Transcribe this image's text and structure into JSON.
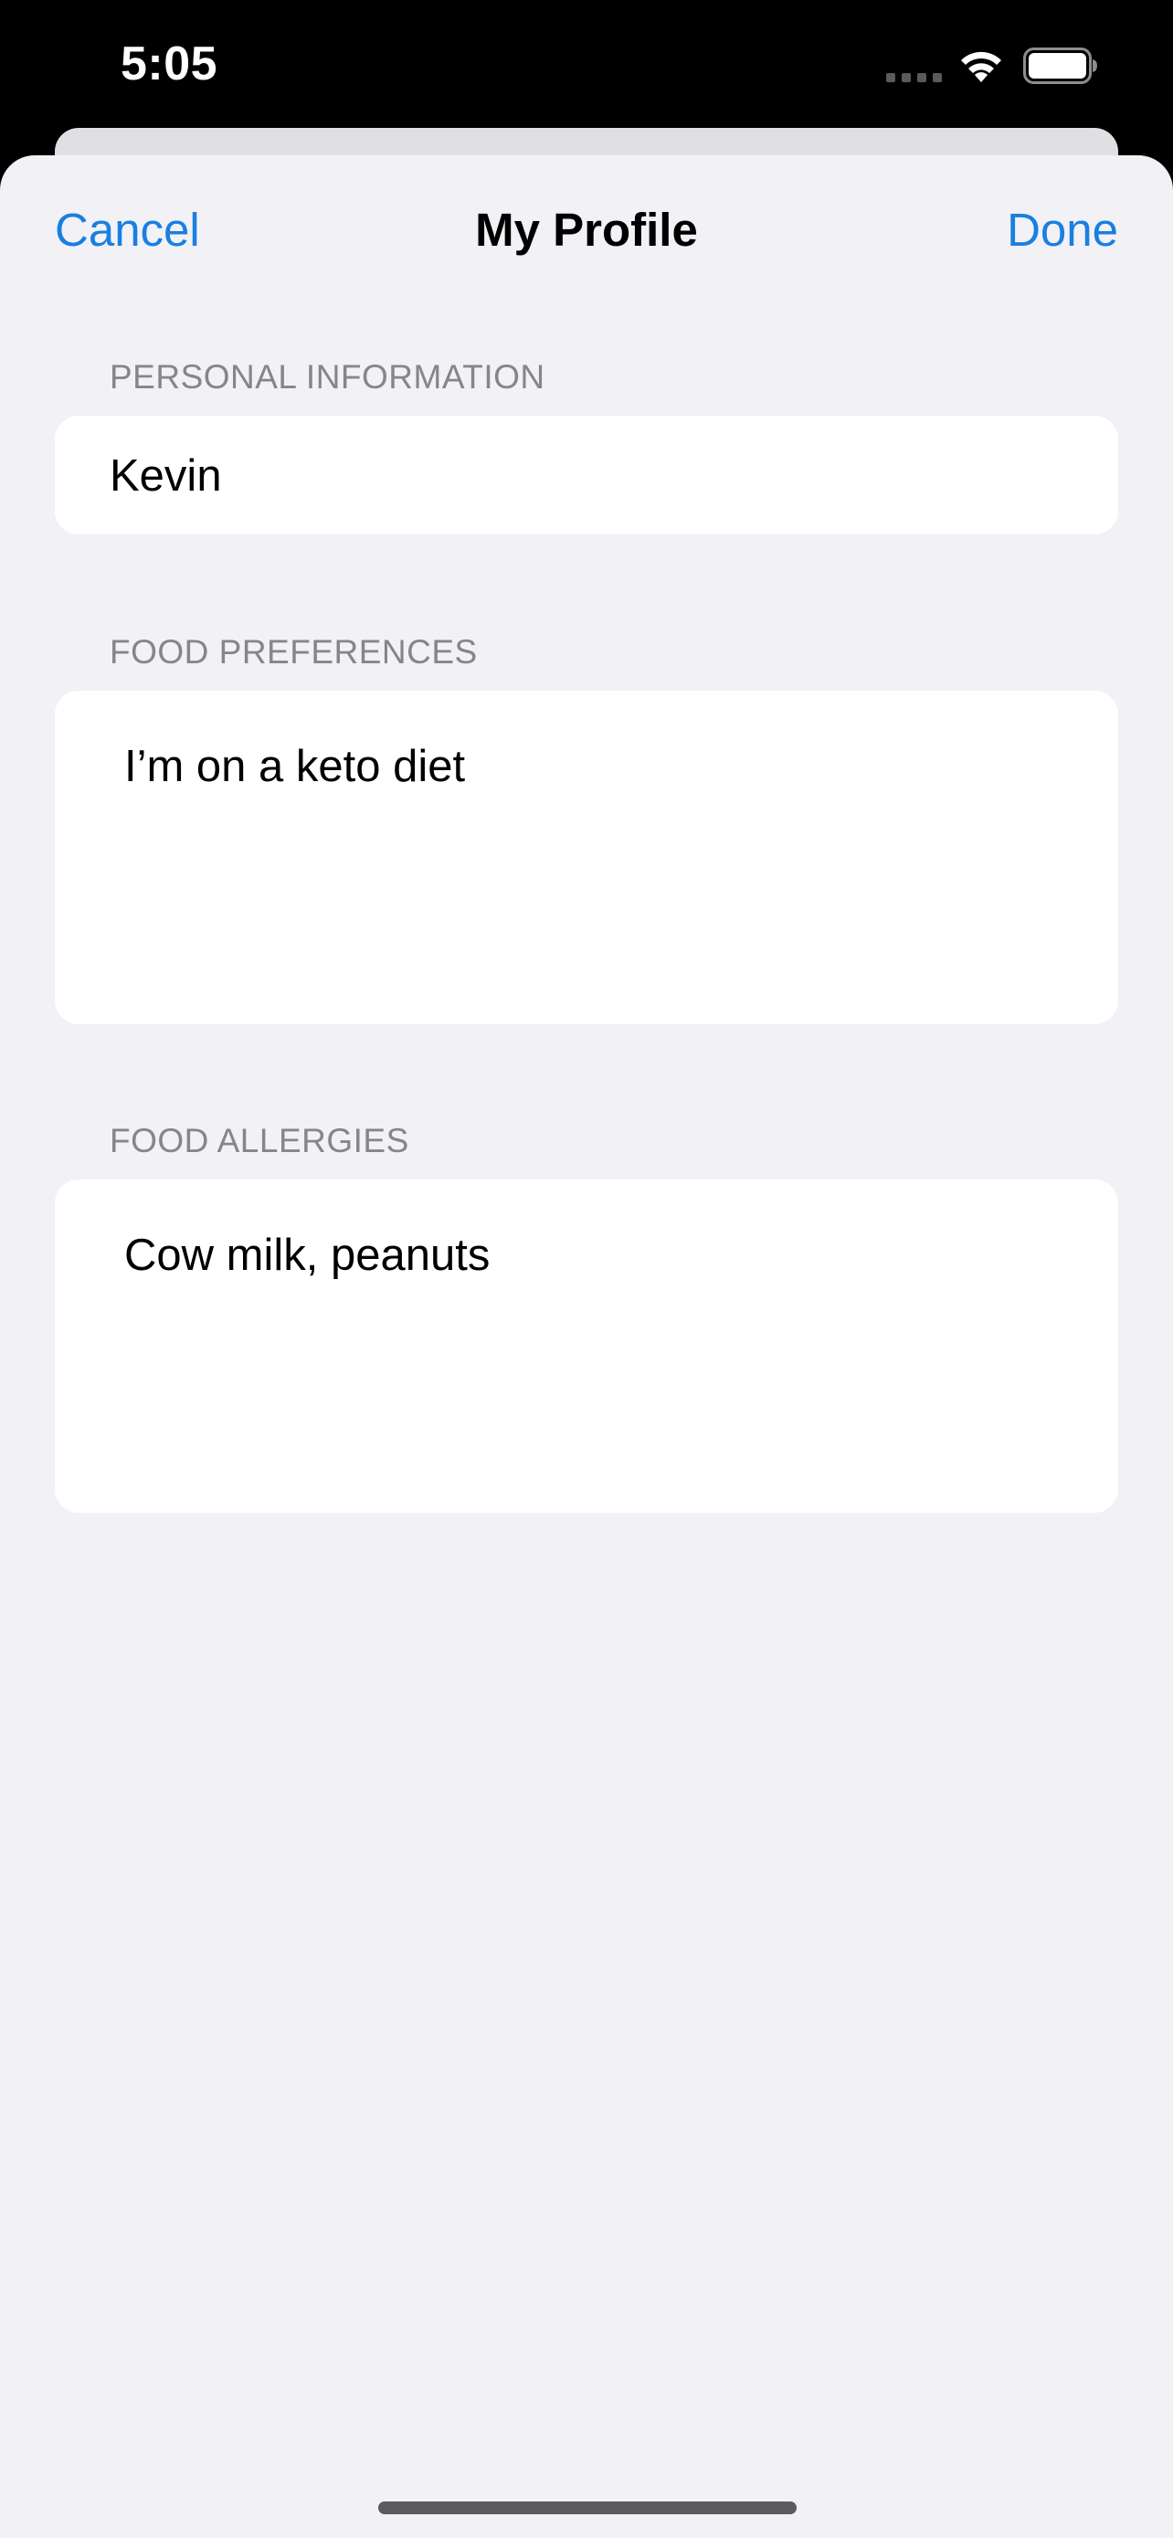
{
  "status_bar": {
    "time": "5:05",
    "icons": [
      "signal-icon",
      "wifi-icon",
      "battery-icon"
    ]
  },
  "nav": {
    "cancel_label": "Cancel",
    "title": "My Profile",
    "done_label": "Done"
  },
  "sections": {
    "personal": {
      "header": "PERSONAL INFORMATION",
      "name_value": "Kevin"
    },
    "preferences": {
      "header": "FOOD PREFERENCES",
      "value": "I’m on a keto diet"
    },
    "allergies": {
      "header": "FOOD ALLERGIES",
      "value": "Cow milk, peanuts"
    }
  },
  "colors": {
    "accent": "#1a7fe0",
    "background": "#f1f1f6",
    "section_header": "#85858a",
    "card": "#ffffff"
  }
}
